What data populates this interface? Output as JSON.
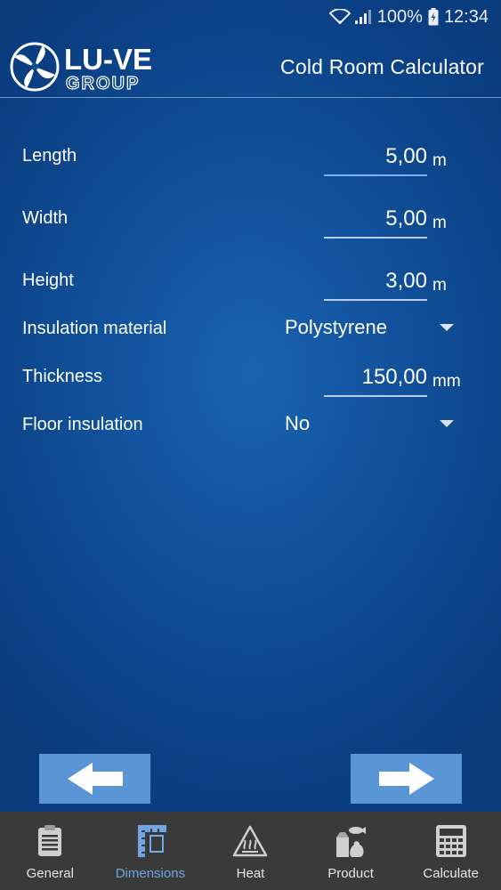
{
  "status_bar": {
    "battery": "100%",
    "time": "12:34"
  },
  "header": {
    "title": "Cold Room Calculator",
    "logo_text_main": "LU-VE",
    "logo_text_sub": "GROUP"
  },
  "fields": [
    {
      "label": "Length",
      "value": "5,00",
      "unit": "m"
    },
    {
      "label": "Width",
      "value": "5,00",
      "unit": "m"
    },
    {
      "label": "Height",
      "value": "3,00",
      "unit": "m"
    }
  ],
  "insulation": {
    "label": "Insulation material",
    "value": "Polystyrene"
  },
  "thickness": {
    "label": "Thickness",
    "value": "150,00",
    "unit": "mm"
  },
  "floor": {
    "label": "Floor insulation",
    "value": "No"
  },
  "tabs": [
    {
      "label": "General",
      "icon": "clipboard-icon"
    },
    {
      "label": "Dimensions",
      "icon": "ruler-square-icon"
    },
    {
      "label": "Heat",
      "icon": "heat-warning-icon"
    },
    {
      "label": "Product",
      "icon": "food-product-icon"
    },
    {
      "label": "Calculate",
      "icon": "calculator-icon"
    }
  ],
  "active_tab": "Dimensions",
  "colors": {
    "background": "#104f98",
    "accent": "#6fa6e3",
    "button": "#5a96d6",
    "tabbar": "#3a3a3a"
  }
}
